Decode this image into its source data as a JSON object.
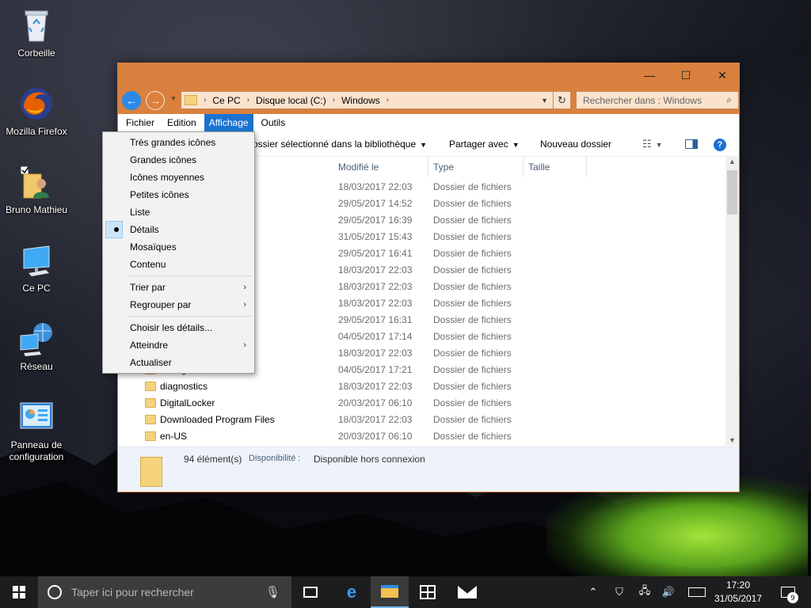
{
  "desktop": {
    "icons": [
      {
        "label": "Corbeille"
      },
      {
        "label": "Mozilla Firefox"
      },
      {
        "label": "Bruno Mathieu"
      },
      {
        "label": "Ce PC"
      },
      {
        "label": "Réseau"
      },
      {
        "label": "Panneau de configuration"
      }
    ]
  },
  "window": {
    "controls": {
      "minimize": "—",
      "maximize": "☐",
      "close": "✕"
    },
    "breadcrumb": [
      "Ce PC",
      "Disque local (C:)",
      "Windows"
    ],
    "search_placeholder": "Rechercher dans : Windows",
    "menu": [
      "Fichier",
      "Edition",
      "Affichage",
      "Outils"
    ],
    "active_menu": "Affichage",
    "toolbar": {
      "include_library": "ossier sélectionné dans la bibliothèque",
      "share": "Partager avec",
      "new_folder": "Nouveau dossier",
      "help": "?"
    },
    "columns": {
      "modified": "Modifié le",
      "type": "Type",
      "size": "Taille"
    },
    "rows": [
      {
        "name": "",
        "date": "18/03/2017 22:03",
        "type": "Dossier de fichiers"
      },
      {
        "name": "",
        "date": "29/05/2017 14:52",
        "type": "Dossier de fichiers"
      },
      {
        "name": "",
        "date": "29/05/2017 16:39",
        "type": "Dossier de fichiers"
      },
      {
        "name": "",
        "date": "31/05/2017 15:43",
        "type": "Dossier de fichiers"
      },
      {
        "name": "",
        "date": "29/05/2017 16:41",
        "type": "Dossier de fichiers"
      },
      {
        "name": "",
        "date": "18/03/2017 22:03",
        "type": "Dossier de fichiers"
      },
      {
        "name": "",
        "date": "18/03/2017 22:03",
        "type": "Dossier de fichiers"
      },
      {
        "name": "",
        "date": "18/03/2017 22:03",
        "type": "Dossier de fichiers"
      },
      {
        "name": "",
        "date": "29/05/2017 16:31",
        "type": "Dossier de fichiers"
      },
      {
        "name": "",
        "date": "04/05/2017 17:14",
        "type": "Dossier de fichiers"
      },
      {
        "name": "",
        "date": "18/03/2017 22:03",
        "type": "Dossier de fichiers"
      },
      {
        "name": "debug",
        "date": "04/05/2017 17:21",
        "type": "Dossier de fichiers"
      },
      {
        "name": "diagnostics",
        "date": "18/03/2017 22:03",
        "type": "Dossier de fichiers"
      },
      {
        "name": "DigitalLocker",
        "date": "20/03/2017 06:10",
        "type": "Dossier de fichiers"
      },
      {
        "name": "Downloaded Program Files",
        "date": "18/03/2017 22:03",
        "type": "Dossier de fichiers"
      },
      {
        "name": "en-US",
        "date": "20/03/2017 06:10",
        "type": "Dossier de fichiers"
      }
    ],
    "status": {
      "count": "94 élément(s)",
      "availability_label": "Disponibilité :",
      "availability_value": "Disponible hors connexion"
    }
  },
  "view_menu": {
    "items": [
      {
        "label": "Très grandes icônes"
      },
      {
        "label": "Grandes icônes"
      },
      {
        "label": "Icônes moyennes"
      },
      {
        "label": "Petites icônes"
      },
      {
        "label": "Liste"
      },
      {
        "label": "Détails",
        "selected": true
      },
      {
        "label": "Mosaïques"
      },
      {
        "label": "Contenu"
      },
      {
        "label": "Trier par",
        "submenu": true
      },
      {
        "label": "Regrouper par",
        "submenu": true
      },
      {
        "label": "Choisir les détails..."
      },
      {
        "label": "Atteindre",
        "submenu": true
      },
      {
        "label": "Actualiser"
      }
    ]
  },
  "taskbar": {
    "search_placeholder": "Taper ici pour rechercher",
    "time": "17:20",
    "date": "31/05/2017",
    "notification_count": "9"
  },
  "colors": {
    "accent": "#d9803e",
    "selection": "#1a73d1",
    "taskbar": "#1d1d1f"
  }
}
